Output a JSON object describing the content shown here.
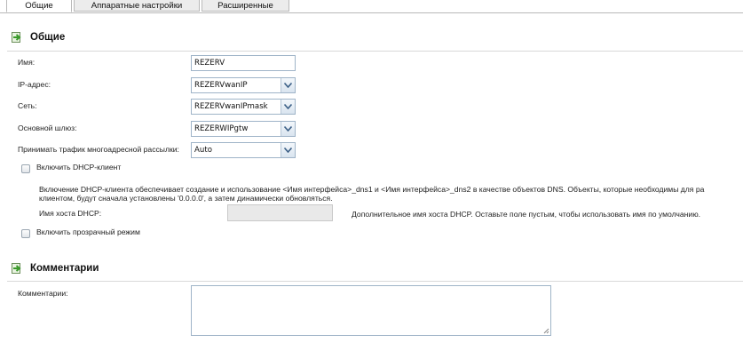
{
  "tabs": [
    {
      "label": "Общие",
      "active": true
    },
    {
      "label": "Аппаратные настройки",
      "active": false
    },
    {
      "label": "Расширенные",
      "active": false
    }
  ],
  "general": {
    "title": "Общие",
    "name_label": "Имя:",
    "name_value": "REZERV",
    "ip_label": "IP-адрес:",
    "ip_value": "REZERVwanIP",
    "net_label": "Сеть:",
    "net_value": "REZERVwanIPmask",
    "gw_label": "Основной шлюз:",
    "gw_value": "REZERWIPgtw",
    "multicast_label": "Принимать трафик многоадресной рассылки:",
    "multicast_value": "Auto",
    "dhcp_label": "Включить DHCP-клиент",
    "dhcp_desc_line1": "Включение DHCP-клиента обеспечивает создание и использование <Имя интерфейса>_dns1 и <Имя интерфейса>_dns2 в качестве объектов DNS. Объекты, которые необходимы для ра",
    "dhcp_desc_line2": "клиентом, будут сначала установлены '0.0.0.0', а затем динамически обновляться.",
    "dhcp_host_label": "Имя хоста DHCP:",
    "dhcp_host_value": "",
    "dhcp_host_hint": "Дополнительное имя хоста DHCP. Оставьте поле пустым, чтобы использовать имя по умолчанию.",
    "transparent_label": "Включить прозрачный режим"
  },
  "comments": {
    "title": "Комментарии",
    "label": "Комментарии:",
    "value": ""
  },
  "colors": {
    "input_border": "#9fb4c8",
    "tab_bg": "#ececec",
    "icon_green": "#3a9a2a"
  }
}
